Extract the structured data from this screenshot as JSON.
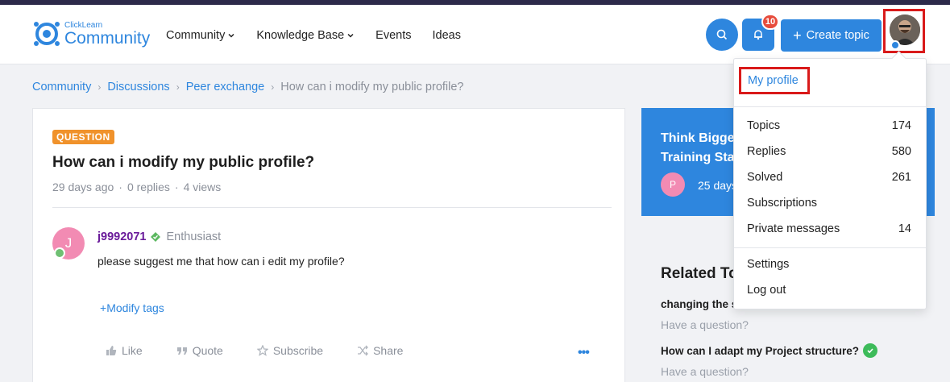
{
  "header": {
    "logo": {
      "small": "ClickLearn",
      "big": "Community"
    },
    "nav": [
      {
        "label": "Community",
        "has_dropdown": true
      },
      {
        "label": "Knowledge Base",
        "has_dropdown": true
      },
      {
        "label": "Events",
        "has_dropdown": false
      },
      {
        "label": "Ideas",
        "has_dropdown": false
      }
    ],
    "notification_count": "10",
    "create_topic_label": "Create topic",
    "icons": {
      "search": "search-icon",
      "bell": "bell-icon",
      "plus": "plus-icon"
    }
  },
  "breadcrumb": [
    {
      "label": "Community"
    },
    {
      "label": "Discussions"
    },
    {
      "label": "Peer exchange"
    },
    {
      "label": "How can i modify my public profile?"
    }
  ],
  "topic": {
    "badge": "QUESTION",
    "title": "How can i modify my public profile?",
    "age": "29 days ago",
    "replies": "0 replies",
    "views": "4 views",
    "post": {
      "avatar_initial": "J",
      "author": "j9992071",
      "role": "Enthusiast",
      "body": "please suggest me that how can i edit my profile?",
      "modify_tags": "Modify tags"
    },
    "actions": {
      "like": "Like",
      "quote": "Quote",
      "subscribe": "Subscribe",
      "share": "Share",
      "more": "•••"
    }
  },
  "promo": {
    "title_line1": "Think Bigger",
    "title_line2": "Training Star",
    "avatar_initial": "P",
    "meta": "25 days"
  },
  "related": {
    "title": "Related To",
    "items": [
      {
        "title": "changing the s",
        "subtitle": "Have a question?",
        "solved": true
      },
      {
        "title": "How can I adapt my Project structure?",
        "subtitle": "Have a question?",
        "solved": true
      }
    ]
  },
  "user_menu": {
    "my_profile": "My profile",
    "stats": [
      {
        "label": "Topics",
        "count": "174"
      },
      {
        "label": "Replies",
        "count": "580"
      },
      {
        "label": "Solved",
        "count": "261"
      },
      {
        "label": "Subscriptions",
        "count": ""
      },
      {
        "label": "Private messages",
        "count": "14"
      }
    ],
    "settings": "Settings",
    "logout": "Log out"
  },
  "colors": {
    "accent": "#2e86de",
    "badge_question": "#f0922b",
    "highlight": "#d91a1a",
    "notification": "#e74c3c",
    "solved": "#3dbb5a"
  }
}
